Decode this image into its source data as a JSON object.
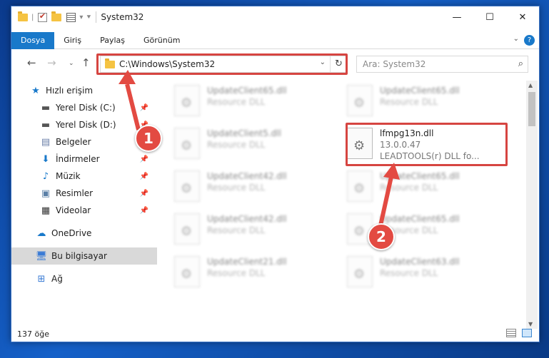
{
  "window": {
    "title": "System32",
    "controls": {
      "minimize": "—",
      "maximize": "☐",
      "close": "✕"
    }
  },
  "ribbon": {
    "tabs": [
      "Dosya",
      "Giriş",
      "Paylaş",
      "Görünüm"
    ],
    "help": "?"
  },
  "nav": {
    "address": "C:\\Windows\\System32",
    "search_placeholder": "Ara: System32"
  },
  "sidebar": {
    "items": [
      {
        "label": "Hızlı erişim",
        "icon": "star-icon"
      },
      {
        "label": "Yerel Disk (C:)",
        "icon": "drive-icon"
      },
      {
        "label": "Yerel Disk (D:)",
        "icon": "drive-icon"
      },
      {
        "label": "Belgeler",
        "icon": "documents-icon"
      },
      {
        "label": "İndirmeler",
        "icon": "download-icon"
      },
      {
        "label": "Müzik",
        "icon": "music-icon"
      },
      {
        "label": "Resimler",
        "icon": "pictures-icon"
      },
      {
        "label": "Videolar",
        "icon": "video-icon"
      },
      {
        "label": "OneDrive",
        "icon": "cloud-icon"
      },
      {
        "label": "Bu bilgisayar",
        "icon": "computer-icon"
      },
      {
        "label": "Ağ",
        "icon": "network-icon"
      }
    ]
  },
  "files": [
    {
      "name": "UpdateClient65.dll",
      "desc": "Resource DLL"
    },
    {
      "name": "UpdateClient65.dll",
      "desc": "Resource DLL"
    },
    {
      "name": "UpdateClient5.dll",
      "desc": "Resource DLL"
    },
    {
      "name": "lfmpg13n.dll",
      "version": "13.0.0.47",
      "desc": "LEADTOOLS(r) DLL fo..."
    },
    {
      "name": "UpdateClient42.dll",
      "desc": "Resource DLL"
    },
    {
      "name": "UpdateClient65.dll",
      "desc": "Resource DLL"
    },
    {
      "name": "UpdateClient42.dll",
      "desc": "Resource DLL"
    },
    {
      "name": "UpdateClient65.dll",
      "desc": "Resource DLL"
    },
    {
      "name": "UpdateClient21.dll",
      "desc": "Resource DLL"
    },
    {
      "name": "UpdateClient63.dll",
      "desc": "Resource DLL"
    }
  ],
  "status": {
    "count": "137 öğe"
  },
  "callouts": {
    "one": "1",
    "two": "2"
  },
  "colors": {
    "accent": "#1979ca",
    "highlight": "#d64541"
  }
}
